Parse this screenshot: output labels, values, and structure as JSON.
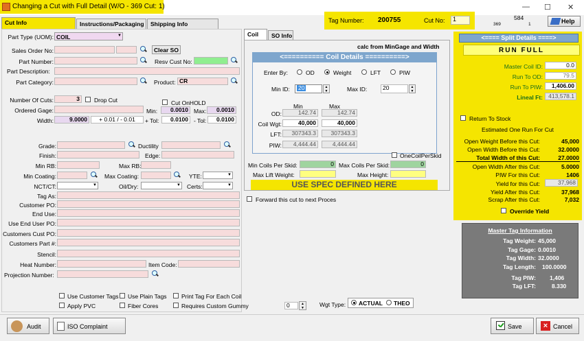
{
  "window": {
    "title": "Changing a Cut with Full Detail  (W/O - 369   Cut: 1)",
    "minimize": "—",
    "maximize": "☐",
    "close": "✕"
  },
  "header": {
    "tag_label": "Tag Number:",
    "tag_value": "200755",
    "cut_label": "Cut No:",
    "cut_value": "1",
    "num_top": "584",
    "num_a": "369",
    "num_b": "1",
    "help_label": "Help"
  },
  "tabs": [
    "Cut Info",
    "Instructions/Packaging",
    "Shipping Info"
  ],
  "form": {
    "part_type_label": "Part Type (UOM):",
    "part_type_value": "COIL",
    "sales_order_label": "Sales Order No:",
    "clear_so": "Clear SO",
    "part_number_label": "Part Number:",
    "resv_label": "Resv Cust No:",
    "part_desc_label": "Part Description:",
    "part_cat_label": "Part Category:",
    "product_label": "Product:",
    "product_value": "CR",
    "num_cuts_label": "Number Of Cuts:",
    "num_cuts_value": "3",
    "drop_cut_label": "Drop Cut",
    "cut_onhold_label": "Cut OnHOLD",
    "ordered_gage_label": "Ordered Gage:",
    "min_label": "Min:",
    "min_value": "0.0010",
    "max_label": "Max:",
    "max_value": "0.0010",
    "width_label": "Width:",
    "width_value": "9.0000",
    "width_tol": "+ 0.01 / - 0.01",
    "ptol_label": "+ Tol:",
    "ptol_value": "0.0100",
    "ntol_label": "- Tol:",
    "ntol_value": "0.0100",
    "grade_label": "Grade:",
    "ductility_label": "Ductility",
    "finish_label": "Finish:",
    "edge_label": "Edge:",
    "minrb_label": "Min RB:",
    "maxrb_label": "Max RB:",
    "mincoat_label": "Min Coating:",
    "maxcoat_label": "Max Coating:",
    "yte_label": "YTE:",
    "nct_label": "NCT/CT:",
    "oildry_label": "Oil/Dry:",
    "certs_label": "Certs:",
    "tagas_label": "Tag As:",
    "custpo_label": "Customer PO:",
    "enduse_label": "End Use:",
    "enduserpo_label": "Use End User PO:",
    "custcoil_label": "Customers Cust PO:",
    "custpart_label": "Customers Part #:",
    "stencil_label": "Stencil:",
    "heat_label": "Heat Number:",
    "itemcode_label": "Item Code:",
    "projnum_label": "Projection Number:"
  },
  "options": {
    "use_cust_tags": "Use Customer Tags",
    "use_plain_tags": "Use Plain Tags",
    "print_tag": "Print Tag For Each Coil",
    "apply_pvc": "Apply PVC",
    "fiber_cores": "Fiber Cores",
    "req_gummy": "Requires Custom Gummy",
    "gummy_value": "0",
    "wgt_type_label": "Wgt Type:",
    "actual_label": "ACTUAL",
    "theo_label": "THEO"
  },
  "coil": {
    "tabs": [
      "Coil",
      "SO Info"
    ],
    "calc_note": "calc from MinGage and Width",
    "title": "<========== Coil Details ==========>",
    "enter_by_label": "Enter By:",
    "od_label": "OD",
    "weight_label": "Weight",
    "lft_label": "LFT",
    "piw_label": "PIW",
    "min_id_label": "Min ID:",
    "min_id_value": "20",
    "max_id_label": "Max ID:",
    "max_id_value": "20",
    "col_min": "Min",
    "col_max": "Max",
    "row_od": "OD:",
    "od_min": "142.74",
    "od_max": "142.74",
    "row_wgt": "Coil Wgt:",
    "wgt_min": "40,000",
    "wgt_max": "40,000",
    "row_lft": "LFT:",
    "lft_min": "307343.3",
    "lft_max": "307343.3",
    "row_piw": "PIW:",
    "piw_min": "4,444.44",
    "piw_max": "4,444.44",
    "one_coil_label": "OneCoilPerSkid",
    "min_coils_label": "Min Coils Per Skid:",
    "min_coils_value": "0",
    "max_coils_label": "Max Coils Per Skid:",
    "max_coils_value": "0",
    "max_lift_label": "Max Lift Weight:",
    "max_height_label": "Max Height:",
    "spec_label": "USE SPEC DEFINED HERE",
    "forward_label": "Forward this cut to next Proces"
  },
  "split": {
    "title": "<==== Split Details ====>",
    "run_full": "RUN  FULL",
    "master_coil_label": "Master Coil ID:",
    "master_coil_value": "0.0",
    "run_od_label": "Run To OD:",
    "run_od_value": "79.5",
    "run_piw_label": "Run To PIW:",
    "run_piw_value": "1,406.00",
    "lineal_label": "Lineal Ft:",
    "lineal_value": "413,578.1",
    "return_label": "Return To Stock",
    "est_label": "Estimated One Run For Cut",
    "rows": [
      {
        "label": "Open Weight Before this Cut:",
        "value": "45,000"
      },
      {
        "label": "Open Width Before this Cut:",
        "value": "32.0000"
      },
      {
        "label": "Total Width of this Cut:",
        "value": "27.0000"
      },
      {
        "label": "Open Width After this Cut:",
        "value": "5.0000"
      },
      {
        "label": "PIW For this Cut:",
        "value": "1406"
      },
      {
        "label": "Yield for this Cut:",
        "value": "37,968"
      },
      {
        "label": "Yield After this Cut:",
        "value": "37,968"
      },
      {
        "label": "Scrap After this Cut:",
        "value": "7,032"
      }
    ],
    "override_label": "Override Yield"
  },
  "master": {
    "title": "Master Tag Information",
    "rows": [
      {
        "label": "Tag Weight:",
        "value": "45,000"
      },
      {
        "label": "Tag Gage:",
        "value": "0.0010"
      },
      {
        "label": "Tag Width:",
        "value": "32.0000"
      },
      {
        "label": "Tag Length:",
        "value": "100.0000"
      },
      {
        "label": "Tag PIW:",
        "value": "1,406"
      },
      {
        "label": "Tag LFT:",
        "value": "8.330"
      }
    ]
  },
  "bottom": {
    "audit": "Audit",
    "iso": "ISO Complaint",
    "save": "Save",
    "cancel": "Cancel"
  }
}
